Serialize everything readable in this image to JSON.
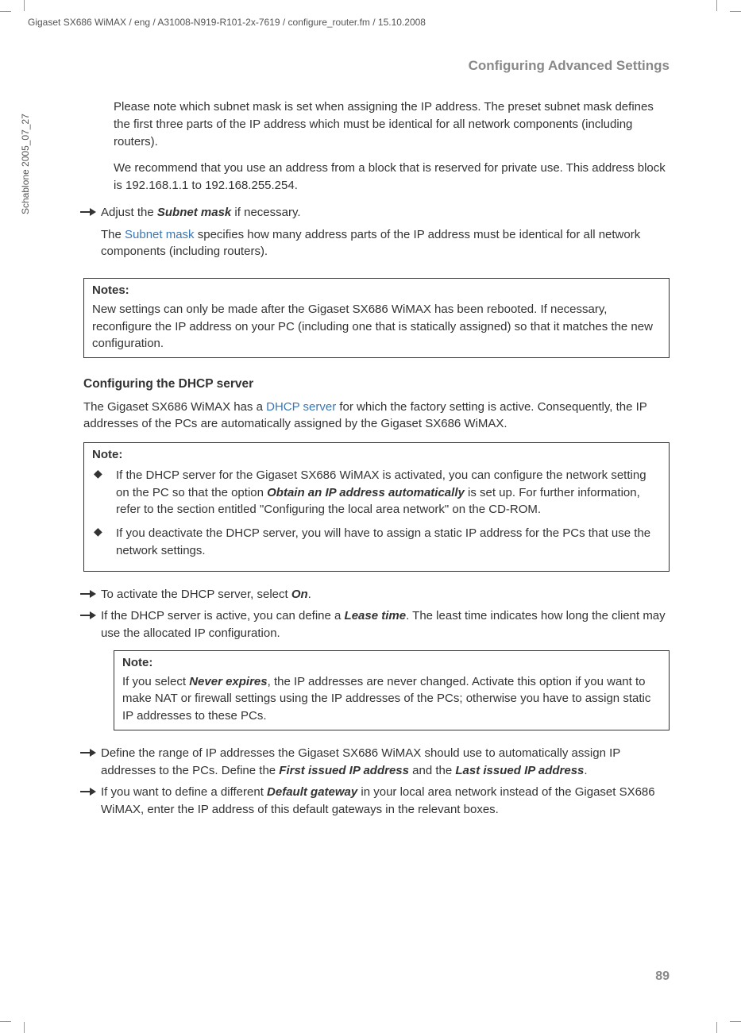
{
  "header_path": "Gigaset SX686 WiMAX / eng / A31008-N919-R101-2x-7619 / configure_router.fm / 15.10.2008",
  "spine_text": "Schablone 2005_07_27",
  "section_header": "Configuring Advanced Settings",
  "p1": "Please note which subnet mask is set when assigning the IP address. The preset subnet mask defines the first three parts of the IP address which must be identical for all network components (including routers).",
  "p2": "We recommend that you use an address from a block that is reserved for private use. This address block is 192.168.1.1 to 192.168.255.254.",
  "arrow1_pre": "Adjust the ",
  "arrow1_b": "Subnet mask",
  "arrow1_post": " if necessary.",
  "p3_pre": "The ",
  "p3_link": "Subnet mask",
  "p3_post": " specifies how many address parts of the IP address must be identical for all network components (including routers).",
  "notes1_title": "Notes:",
  "notes1_body": "New settings can only be made after the Gigaset SX686 WiMAX has been rebooted. If necessary, reconfigure the IP address on your PC (including one that is statically assigned) so that it matches the new configuration.",
  "sub1": "Configuring the DHCP server",
  "p4_pre": "The Gigaset SX686 WiMAX has a ",
  "p4_link": "DHCP server",
  "p4_post": " for which the factory setting is active. Consequently, the IP addresses of the PCs are automatically assigned by the Gigaset SX686 WiMAX.",
  "note2_title": "Note:",
  "note2_li1_pre": "If the DHCP server for the Gigaset SX686 WiMAX is activated, you can configure the network setting on the PC so that the option ",
  "note2_li1_b": "Obtain an IP address automatically",
  "note2_li1_post": " is set up. For further information, refer to the section entitled \"Configuring the local area network\" on the CD-ROM.",
  "note2_li2": "If you deactivate the DHCP server, you will have to assign a static IP address for the PCs that use the network settings.",
  "arrow2_pre": "To activate the DHCP server, select ",
  "arrow2_b": "On",
  "arrow2_post": ".",
  "arrow3_pre": "If the DHCP server is active, you can define a ",
  "arrow3_b": "Lease time",
  "arrow3_post": ". The least time indicates how long the client may use the allocated IP configuration.",
  "note3_title": "Note:",
  "note3_pre": "If you select ",
  "note3_b": "Never expires",
  "note3_post": ", the IP addresses are never changed. Activate this option if you want to make NAT or firewall settings using the IP addresses of the PCs; otherwise you have to assign static IP addresses to these PCs.",
  "arrow4_pre": "Define the range of IP addresses the Gigaset SX686 WiMAX should use to automatically assign IP addresses to the PCs. Define the ",
  "arrow4_b1": "First issued IP address",
  "arrow4_mid": " and the ",
  "arrow4_b2": "Last issued IP address",
  "arrow4_post": ".",
  "arrow5_pre": "If you want to define a different ",
  "arrow5_b": "Default gateway",
  "arrow5_post": " in your local area network instead of the Gigaset SX686 WiMAX, enter the IP address of this default gateways in the relevant boxes.",
  "page_number": "89"
}
